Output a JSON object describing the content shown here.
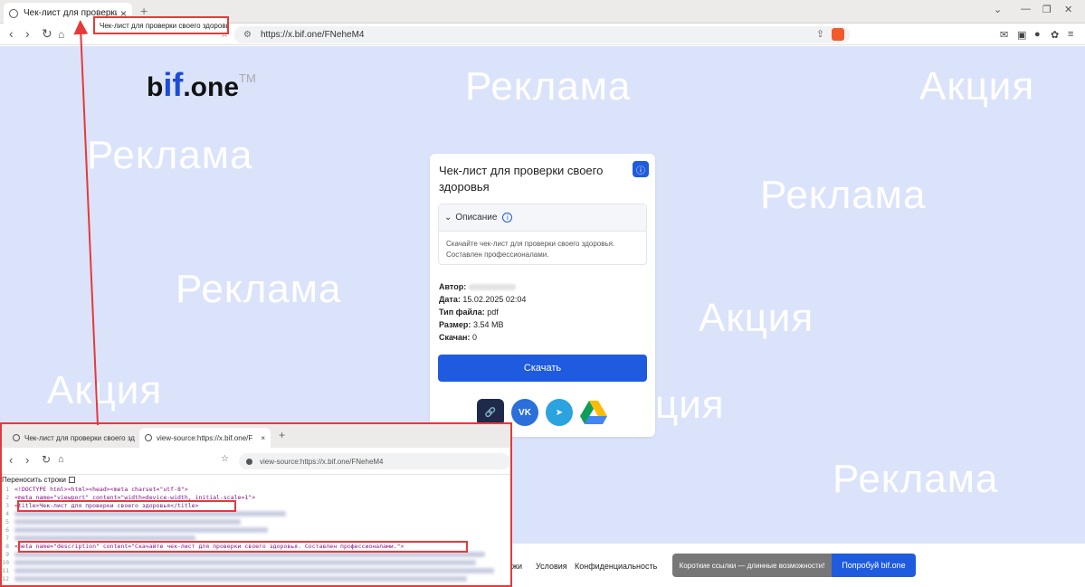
{
  "browser": {
    "tab_title": "Чек-лист для проверки своег",
    "url": "https://x.bif.one/FNeheM4",
    "annotation_title": "Чек-лист для проверки своего здоровья"
  },
  "page": {
    "logo_pre": "b",
    "logo_if": "if",
    "logo_post": ".one",
    "logo_tm": "TM",
    "watermarks": {
      "w1": "Реклама",
      "w2": "Акция",
      "w3": "Реклама",
      "w4": "Реклама",
      "w5": "Реклама",
      "w6": "Акция",
      "w7": "Акция",
      "w8": "ция",
      "w9": "Реклама"
    },
    "card": {
      "title": "Чек-лист для проверки своего здоровья",
      "desc_label": "Описание",
      "desc_text": "Скачайте чек-лист для проверки своего здоровья. Составлен профессионалами.",
      "author_label": "Автор:",
      "date_label": "Дата:",
      "date_value": "15.02.2025 02:04",
      "type_label": "Тип файла:",
      "type_value": "pdf",
      "size_label": "Размер:",
      "size_value": "3.54 MB",
      "downloads_label": "Скачан:",
      "downloads_value": "0",
      "download_button": "Скачать",
      "vk_label": "VK"
    },
    "footer": {
      "link_partial": "жи",
      "terms": "Условия",
      "privacy": "Конфиденциальность",
      "promo": "Короткие ссылки — длинные возможности!",
      "promo_button": "Попробуй bif.one"
    }
  },
  "source_view": {
    "tab1": "Чек-лист для проверки своего зд",
    "tab2": "view-source:https://x.bif.one/F",
    "url": "view-source:https://x.bif.one/FNeheM4",
    "wrap_label": "Переносить строки",
    "line1": "<!DOCTYPE html><html><head><meta charset=\"utf-8\">",
    "line2": "<meta name=\"viewport\" content=\"width=device-width, initial-scale=1\">",
    "line3": "<title>Чек-лист для проверки своего здоровья</title>",
    "line8": "<meta name=\"description\" content=\"Скачайте чек-лист для проверки своего здоровья. Составлен профессионалами.\">",
    "line_numbers": [
      "1",
      "2",
      "3",
      "4",
      "5",
      "6",
      "7",
      "8",
      "9",
      "10",
      "11",
      "12"
    ]
  }
}
